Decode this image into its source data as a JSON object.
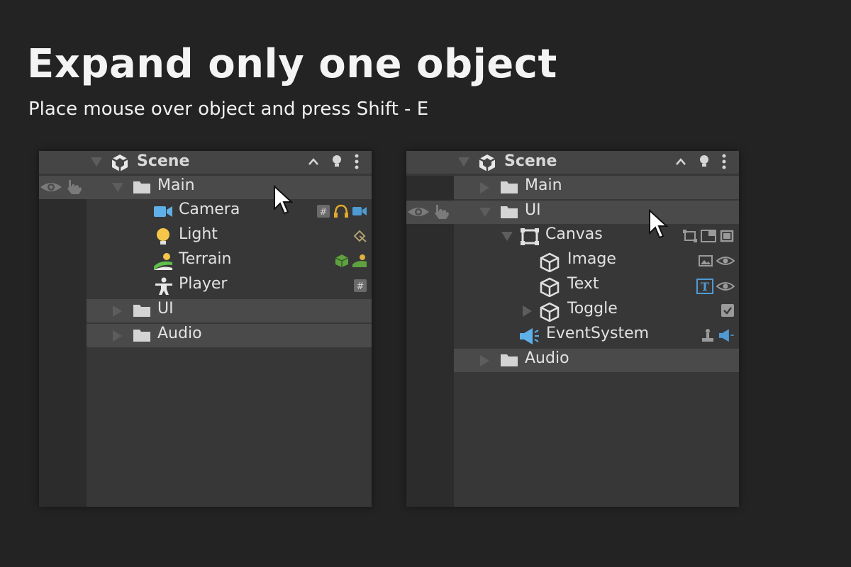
{
  "headline": "Expand only one object",
  "subline": "Place mouse over object and press Shift - E",
  "left_panel": {
    "scene_label": "Scene",
    "rows": {
      "main": "Main",
      "camera": "Camera",
      "light": "Light",
      "terrain": "Terrain",
      "player": "Player",
      "ui": "UI",
      "audio": "Audio"
    },
    "expanded_object": "Main"
  },
  "right_panel": {
    "scene_label": "Scene",
    "rows": {
      "main": "Main",
      "ui": "UI",
      "canvas": "Canvas",
      "image": "Image",
      "text": "Text",
      "toggle": "Toggle",
      "eventsystem": "EventSystem",
      "audio": "Audio"
    },
    "expanded_object": "UI",
    "toggle_checked": true
  },
  "colors": {
    "background": "#232323",
    "panel": "#373737",
    "row_highlight": "#4a4a4a",
    "camera_icon": "#5fb0e8",
    "light_icon": "#f5c64a",
    "terrain_icon": "#5fbf4a",
    "script_icon": "#7aa86a"
  },
  "icons": [
    "unity-scene-icon",
    "folder-icon",
    "camera-icon",
    "light-icon",
    "terrain-icon",
    "player-icon",
    "eye-icon",
    "hand-icon",
    "cube-icon",
    "canvas-icon",
    "megaphone-icon",
    "checkbox-icon",
    "text-T-icon"
  ]
}
